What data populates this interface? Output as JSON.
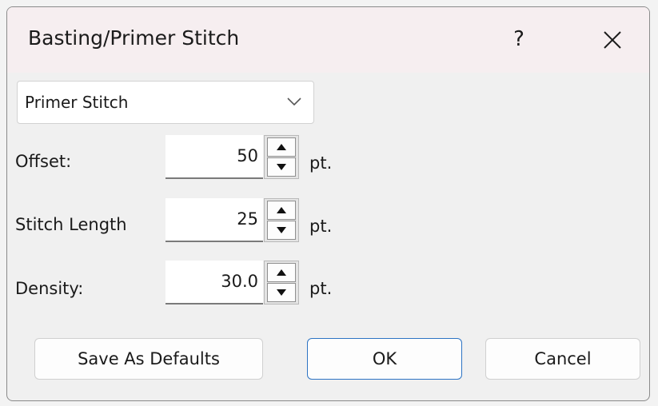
{
  "window": {
    "title": "Basting/Primer Stitch",
    "help_label": "?",
    "close_icon": "close-icon"
  },
  "stitch_type": {
    "selected": "Primer Stitch"
  },
  "fields": {
    "offset": {
      "label": "Offset:",
      "value": "50",
      "unit": "pt."
    },
    "stitch_length": {
      "label": "Stitch Length",
      "value": "25",
      "unit": "pt."
    },
    "density": {
      "label": "Density:",
      "value": "30.0",
      "unit": "pt."
    }
  },
  "buttons": {
    "save_defaults": "Save As Defaults",
    "ok": "OK",
    "cancel": "Cancel"
  },
  "colors": {
    "titlebar": "#f6eef0",
    "dialog_bg": "#f0f0f0",
    "accent_border": "#2d74c4"
  }
}
